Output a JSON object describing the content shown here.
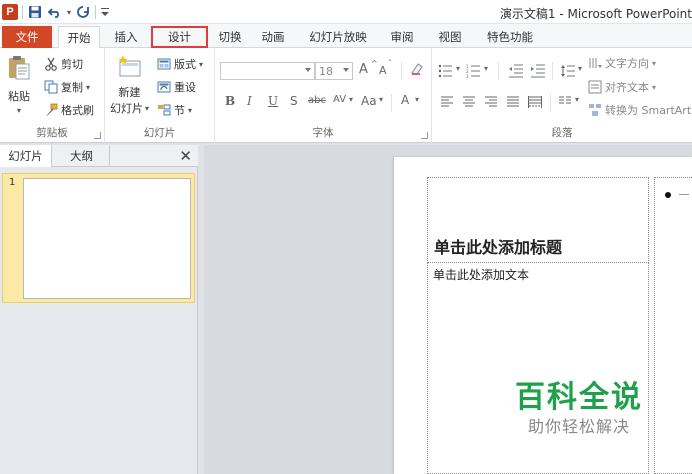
{
  "window": {
    "app_logo": "P",
    "title": "演示文稿1 - Microsoft PowerPoint"
  },
  "tabs": [
    {
      "label": "文件",
      "state": "file"
    },
    {
      "label": "开始",
      "state": "active"
    },
    {
      "label": "插入",
      "state": ""
    },
    {
      "label": "设计",
      "state": "highlighted"
    },
    {
      "label": "切换",
      "state": ""
    },
    {
      "label": "动画",
      "state": ""
    },
    {
      "label": "幻灯片放映",
      "state": ""
    },
    {
      "label": "审阅",
      "state": ""
    },
    {
      "label": "视图",
      "state": ""
    },
    {
      "label": "特色功能",
      "state": ""
    }
  ],
  "ribbon": {
    "clipboard": {
      "label": "剪贴板",
      "paste": "粘贴",
      "cut": "剪切",
      "copy": "复制",
      "format_painter": "格式刷"
    },
    "slides": {
      "label": "幻灯片",
      "new_slide_line1": "新建",
      "new_slide_line2": "幻灯片",
      "layout": "版式",
      "reset": "重设",
      "section": "节"
    },
    "font": {
      "label": "字体",
      "font_name": "",
      "font_size": "18",
      "grow": "A",
      "shrink": "A",
      "bold": "B",
      "italic": "I",
      "underline": "U",
      "shadow": "S",
      "strike": "abc",
      "spacing": "AV",
      "case": "Aa",
      "color": "A"
    },
    "paragraph": {
      "label": "段落",
      "text_direction": "文字方向",
      "align_text": "对齐文本",
      "smartart": "转换为 SmartArt"
    }
  },
  "leftpane": {
    "tab_slides": "幻灯片",
    "tab_outline": "大纲",
    "close": "✕",
    "slide_number": "1"
  },
  "slide": {
    "title_placeholder": "单击此处添加标题",
    "body_placeholder": "单击此处添加文本"
  },
  "watermark": {
    "title": "百科全说",
    "subtitle": "助你轻松解决"
  },
  "colors": {
    "file_tab": "#d24726",
    "highlight": "#e33b3b",
    "thumb_selected": "#fbe9a6",
    "watermark": "#1fa14a"
  }
}
